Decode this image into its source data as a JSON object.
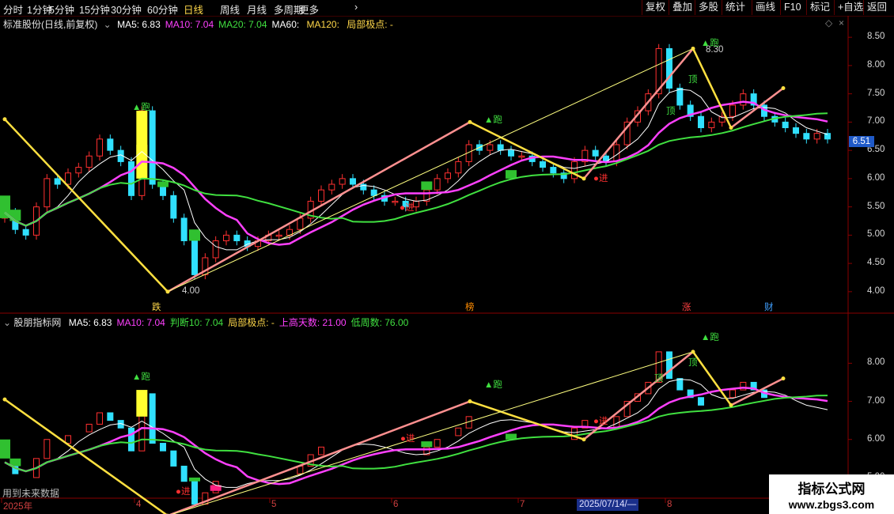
{
  "toolbar": {
    "periods": [
      "分时",
      "1分钟",
      "5分钟",
      "15分钟",
      "30分钟",
      "60分钟",
      "日线",
      "周线",
      "月线",
      "多周期",
      "更多"
    ],
    "active_period": "日线",
    "right_buttons": [
      "复权",
      "叠加",
      "多股",
      "统计",
      "画线",
      "F10",
      "标记",
      "+自选",
      "返回"
    ]
  },
  "main_panel": {
    "title": "标准股份(日线,前复权)",
    "legend": [
      {
        "text": "MA5: 6.83",
        "color": "#ffffff"
      },
      {
        "text": "MA10: 7.04",
        "color": "#ff40ff"
      },
      {
        "text": "MA20: 7.04",
        "color": "#40e040"
      },
      {
        "text": "MA60: ",
        "color": "#ffffff"
      },
      {
        "text": "MA120: ",
        "color": "#ffd84a"
      },
      {
        "text": "局部极点: -",
        "color": "#ffd84a"
      }
    ],
    "y_ticks": [
      "8.50",
      "8.00",
      "7.50",
      "7.00",
      "6.50",
      "6.00",
      "5.50",
      "5.00",
      "4.50",
      "4.00"
    ],
    "y_range": [
      3.9,
      8.6
    ],
    "current_price": "6.51",
    "high_label": "8.30",
    "low_label": "4.00",
    "bottom_markers": [
      {
        "text": "跌",
        "color": "#ffd84a"
      },
      {
        "text": "榜",
        "color": "#ff8c00"
      },
      {
        "text": "涨",
        "color": "#ff4040"
      },
      {
        "text": "财",
        "color": "#40a0ff"
      }
    ]
  },
  "sub_panel": {
    "title": "股朋指标网",
    "legend": [
      {
        "text": "MA5: 6.83",
        "color": "#ffffff"
      },
      {
        "text": "MA10: 7.04",
        "color": "#ff40ff"
      },
      {
        "text": "判断10: 7.04",
        "color": "#40e040"
      },
      {
        "text": "局部极点: -",
        "color": "#ffd84a"
      },
      {
        "text": "上高天数: 21.00",
        "color": "#ff40ff"
      },
      {
        "text": "低周数: 76.00",
        "color": "#40e040"
      }
    ],
    "y_ticks": [
      "8.00",
      "7.00",
      "6.00",
      "5.00"
    ],
    "y_range": [
      4.5,
      8.9
    ],
    "footnote": "用到未来数据"
  },
  "signals": {
    "run": "▲跑",
    "enter": "●进",
    "top": "顶"
  },
  "date_axis": {
    "labels": [
      "2025年",
      "4",
      "5",
      "6",
      "7",
      "8"
    ],
    "cursor_date": "2025/07/14/—"
  },
  "watermark": {
    "line1": "指标公式网",
    "line2": "www.zbgs3.com"
  },
  "colors": {
    "up": "#ff3030",
    "down": "#30e0ff",
    "ma5": "#ffffff",
    "ma10": "#ff40ff",
    "ma20": "#40e040",
    "zigzag_up": "#ff9090",
    "zigzag_down": "#ffe040",
    "trend": "#ffff80"
  },
  "chart_data": {
    "type": "candlestick",
    "zigzag_extremes": [
      {
        "label": "start",
        "price": 7.05
      },
      {
        "label": "low",
        "price": 4.0
      },
      {
        "label": "high",
        "price": 7.0
      },
      {
        "label": "low",
        "price": 6.0
      },
      {
        "label": "high",
        "price": 8.3
      },
      {
        "label": "low",
        "price": 6.9
      },
      {
        "label": "high",
        "price": 7.6
      }
    ],
    "close_series": [
      5.4,
      5.1,
      5.0,
      5.5,
      6.0,
      5.9,
      6.1,
      6.2,
      6.4,
      6.7,
      6.5,
      6.3,
      5.7,
      7.2,
      5.9,
      5.7,
      5.3,
      4.9,
      4.3,
      4.6,
      4.9,
      5.0,
      4.9,
      4.8,
      4.9,
      5.0,
      5.0,
      5.1,
      5.3,
      5.6,
      5.8,
      5.9,
      6.0,
      5.9,
      5.8,
      5.7,
      5.6,
      5.6,
      5.5,
      5.6,
      5.8,
      6.0,
      6.1,
      6.3,
      6.6,
      6.5,
      6.6,
      6.5,
      6.4,
      6.4,
      6.3,
      6.2,
      6.1,
      6.0,
      6.3,
      6.5,
      6.4,
      6.3,
      6.6,
      7.0,
      7.2,
      7.5,
      8.3,
      7.6,
      7.3,
      7.1,
      6.9,
      7.0,
      7.1,
      7.3,
      7.5,
      7.3,
      7.1,
      7.0,
      6.9,
      6.8,
      6.7,
      6.8,
      6.7
    ]
  }
}
